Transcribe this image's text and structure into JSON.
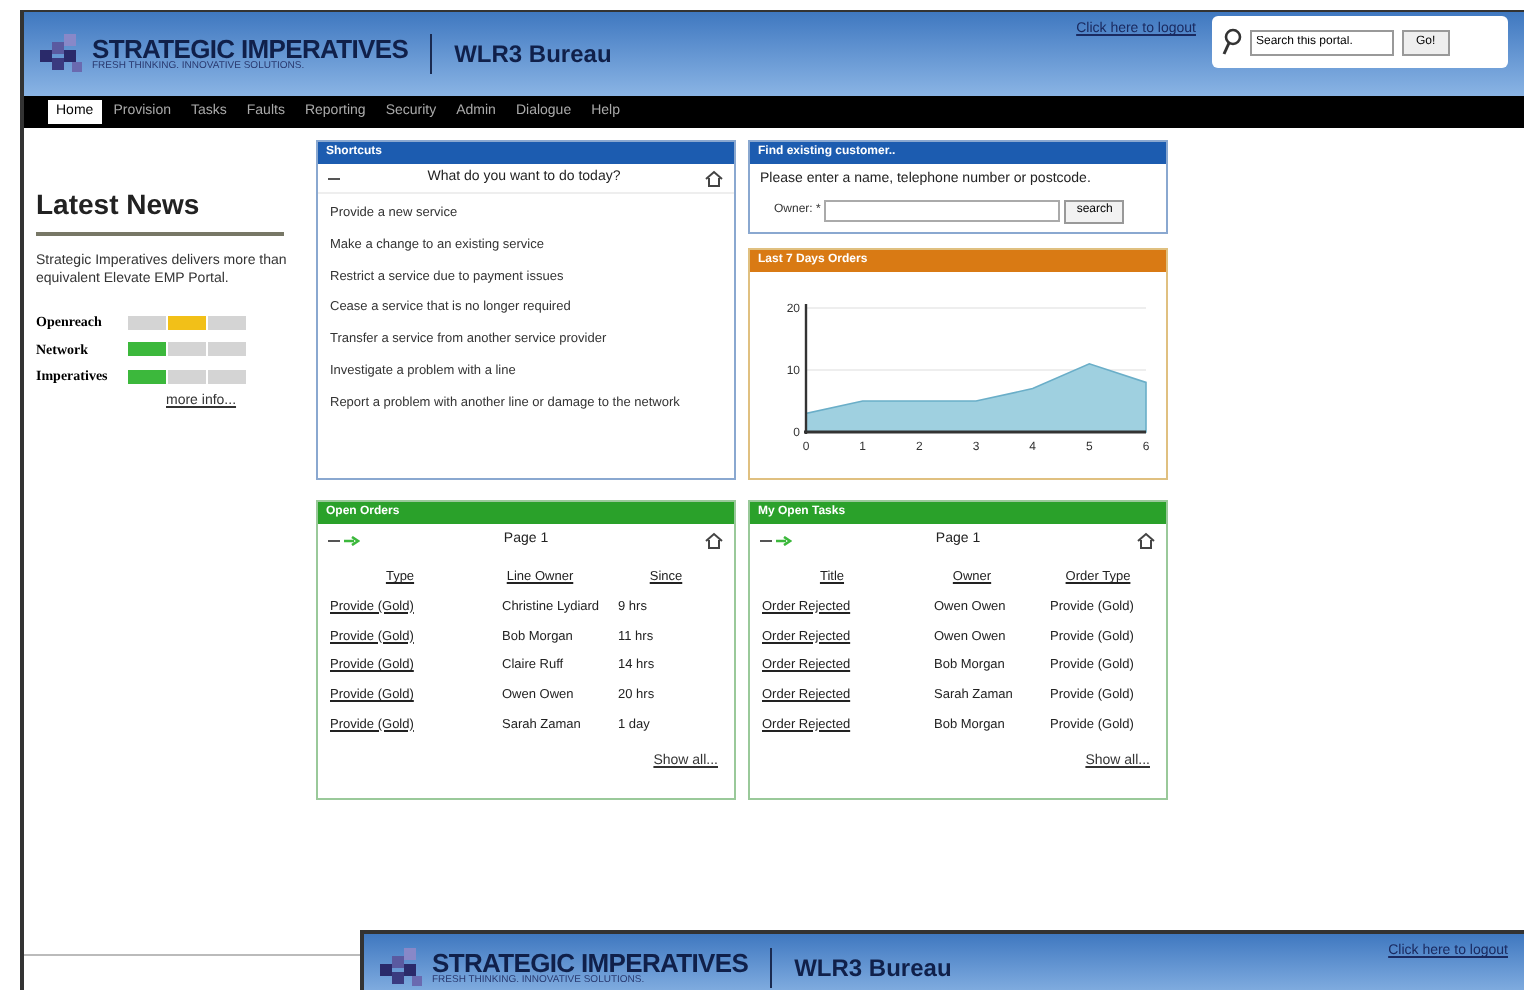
{
  "header": {
    "logo_title": "STRATEGIC IMPERATIVES",
    "logo_tagline": "FRESH THINKING. INNOVATIVE SOLUTIONS.",
    "app_title": "WLR3 Bureau",
    "logout_link": "Click here to logout",
    "search": {
      "placeholder": "Search this portal.",
      "button": "Go!"
    }
  },
  "nav": [
    {
      "label": "Home",
      "selected": true
    },
    {
      "label": "Provision",
      "selected": false
    },
    {
      "label": "Tasks",
      "selected": false
    },
    {
      "label": "Faults",
      "selected": false
    },
    {
      "label": "Reporting",
      "selected": false
    },
    {
      "label": "Security",
      "selected": false
    },
    {
      "label": "Admin",
      "selected": false
    },
    {
      "label": "Dialogue",
      "selected": false
    },
    {
      "label": "Help",
      "selected": false
    }
  ],
  "latest_news": {
    "title": "Latest News",
    "text": "Strategic Imperatives delivers more than equivalent Elevate EMP Portal.",
    "statuses": [
      {
        "name": "Openreach",
        "color": "#f2c018",
        "segments": [
          {
            "lit": false
          },
          {
            "lit": true
          },
          {
            "lit": false
          }
        ]
      },
      {
        "name": "Network",
        "color": "#3cb83c",
        "segments": [
          {
            "lit": true
          },
          {
            "lit": false
          },
          {
            "lit": false
          }
        ]
      },
      {
        "name": "Imperatives",
        "color": "#3cb83c",
        "segments": [
          {
            "lit": true
          },
          {
            "lit": false
          },
          {
            "lit": false
          }
        ]
      }
    ],
    "more_link": "more info..."
  },
  "shortcuts": {
    "title": "Shortcuts",
    "heading": "What do you want to do today?",
    "items": [
      "Provide a new service",
      "Make a change to an existing service",
      "Restrict a service due to payment issues",
      "Cease a service that is no longer required",
      "Transfer a service from another service provider",
      "Investigate a problem with a line",
      "Report a problem with another line or damage to the network"
    ]
  },
  "find_customer": {
    "title": "Find existing customer..",
    "prompt": "Please enter a name, telephone number or postcode.",
    "field_label": "Owner: *",
    "button": "search"
  },
  "orders_chart": {
    "title": "Last 7 Days Orders",
    "chart_data": {
      "type": "area",
      "x": [
        0,
        1,
        2,
        3,
        4,
        5,
        6
      ],
      "series": [
        {
          "color": "#9fd0e0",
          "values": [
            3,
            5,
            5,
            5,
            7,
            11,
            8
          ]
        }
      ],
      "xticks": [
        0,
        1,
        2,
        3,
        4,
        5,
        6
      ],
      "yticks": [
        0,
        10,
        20
      ],
      "xlim": [
        0,
        6
      ],
      "ylim": [
        0,
        20
      ]
    }
  },
  "open_orders": {
    "title": "Open Orders",
    "page": "Page 1",
    "columns": [
      "Type",
      "Line Owner",
      "Since"
    ],
    "rows": [
      [
        "Provide (Gold)",
        "Christine Lydiard",
        "9 hrs"
      ],
      [
        "Provide (Gold)",
        "Bob Morgan",
        "11 hrs"
      ],
      [
        "Provide (Gold)",
        "Claire Ruff",
        "14 hrs"
      ],
      [
        "Provide (Gold)",
        "Owen Owen",
        "20 hrs"
      ],
      [
        "Provide (Gold)",
        "Sarah Zaman",
        "1 day"
      ]
    ],
    "show_all": "Show all..."
  },
  "open_tasks": {
    "title": "My Open Tasks",
    "page": "Page 1",
    "columns": [
      "Title",
      "Owner",
      "Order Type"
    ],
    "rows": [
      [
        "Order Rejected",
        "Owen Owen",
        "Provide (Gold)"
      ],
      [
        "Order Rejected",
        "Owen Owen",
        "Provide (Gold)"
      ],
      [
        "Order Rejected",
        "Bob Morgan",
        "Provide (Gold)"
      ],
      [
        "Order Rejected",
        "Sarah Zaman",
        "Provide (Gold)"
      ],
      [
        "Order Rejected",
        "Bob Morgan",
        "Provide (Gold)"
      ]
    ],
    "show_all": "Show all..."
  },
  "second_window": {
    "logo_title": "STRATEGIC IMPERATIVES",
    "logo_tagline": "FRESH THINKING. INNOVATIVE SOLUTIONS.",
    "app_title": "WLR3 Bureau",
    "logout_link": "Click here to logout"
  }
}
